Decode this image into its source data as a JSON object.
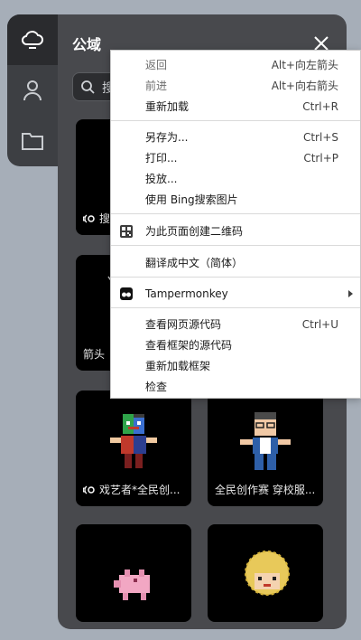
{
  "panel": {
    "title": "公域",
    "search_value": "搜"
  },
  "cards": [
    {
      "label": "搜",
      "live": true
    },
    {
      "label": "",
      "live": false
    },
    {
      "label": "箭头",
      "live": false
    },
    {
      "label": "",
      "live": false
    },
    {
      "label": "戏艺者*全民创...",
      "live": true
    },
    {
      "label": "全民创作赛 穿校服...",
      "live": false
    },
    {
      "label": "",
      "live": false
    },
    {
      "label": "",
      "live": false
    }
  ],
  "context_menu": {
    "back": {
      "label": "返回",
      "shortcut": "Alt+向左箭头"
    },
    "forward": {
      "label": "前进",
      "shortcut": "Alt+向右箭头"
    },
    "reload": {
      "label": "重新加载",
      "shortcut": "Ctrl+R"
    },
    "save_as": {
      "label": "另存为...",
      "shortcut": "Ctrl+S"
    },
    "print": {
      "label": "打印...",
      "shortcut": "Ctrl+P"
    },
    "cast": {
      "label": "投放..."
    },
    "bing_search": {
      "label": "使用 Bing搜索图片"
    },
    "qr_code": {
      "label": "为此页面创建二维码"
    },
    "translate": {
      "label": "翻译成中文（简体）"
    },
    "tampermonkey": {
      "label": "Tampermonkey"
    },
    "view_source": {
      "label": "查看网页源代码",
      "shortcut": "Ctrl+U"
    },
    "view_frame_source": {
      "label": "查看框架的源代码"
    },
    "reload_frame": {
      "label": "重新加载框架"
    },
    "inspect": {
      "label": "检查"
    }
  }
}
